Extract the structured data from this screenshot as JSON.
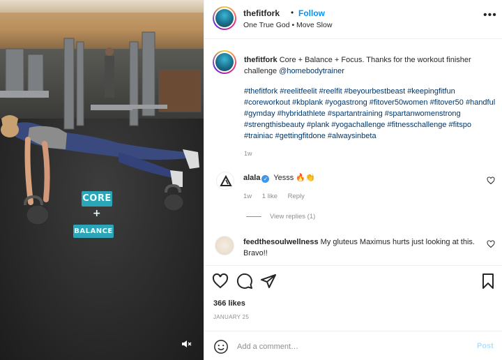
{
  "post": {
    "username": "thefitfork",
    "follow_label": "Follow",
    "separator": "•",
    "audio": "One True God • Move Slow",
    "more_label": "•••",
    "media_overlay": {
      "line1": "CORE",
      "line2": "+",
      "line3": "BALANCE"
    }
  },
  "caption": {
    "username": "thefitfork",
    "text": "Core + Balance + Focus. Thanks for the workout finisher challenge",
    "mention": "@homebodytrainer",
    "hashtags": "#thefitfork #reelitfeelit #reelfit #beyourbestbeast #keepingfitfun #coreworkout #kbplank #yogastrong #fitover50women #fitover50 #handful #gymday #hybridathlete #spartantraining #spartanwomenstrong #strengthisbeauty #plank #yogachallenge #fitnesschallenge #fitspo #trainiac #gettingfitdone #alwaysinbeta",
    "time": "1w"
  },
  "comments": [
    {
      "username": "alala",
      "text": "Yesss 🔥👏",
      "time": "1w",
      "likes": "1 like",
      "reply_label": "Reply",
      "view_replies": "View replies (1)"
    },
    {
      "username": "feedthesoulwellness",
      "text": "My gluteus Maximus hurts just looking at this. Bravo!!"
    }
  ],
  "footer": {
    "likes": "366 likes",
    "date": "JANUARY 25",
    "comment_placeholder": "Add a comment…",
    "post_label": "Post"
  },
  "colors": {
    "link": "#00376b",
    "follow": "#0095f6",
    "overlay": "#2aa6b8",
    "muted": "#8e8e8e"
  }
}
